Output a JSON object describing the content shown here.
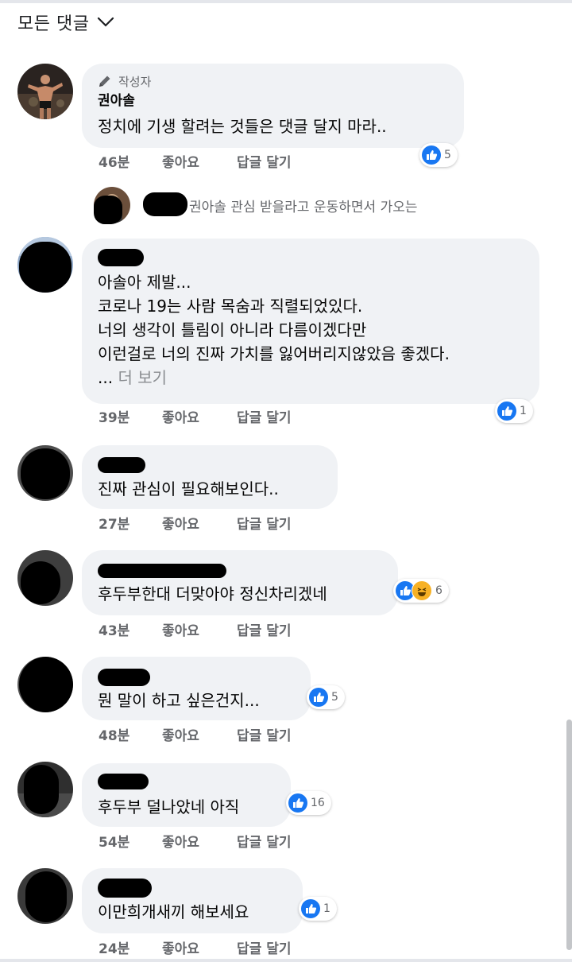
{
  "header": {
    "filter_label": "모든 댓글"
  },
  "action_labels": {
    "like": "좋아요",
    "reply": "답글 달기"
  },
  "comments": [
    {
      "author_badge": "작성자",
      "author": "권아솔",
      "text": "정치에 기생 할려는 것들은 댓글 달지 마라..",
      "time": "46분",
      "reaction_count": "5",
      "reaction_types": [
        "like"
      ]
    },
    {
      "author": "",
      "text": "아솔아 제발...\n코로나 19는 사람 목숨과 직렬되었있다.\n너의 생각이 틀림이 아니라 다름이겠다만\n이런걸로 너의 진짜 가치를 잃어버리지않았음 좋겠다.",
      "see_more_prefix": "... ",
      "see_more": "더 보기",
      "time": "39분",
      "reaction_count": "1",
      "reaction_types": [
        "like"
      ]
    },
    {
      "author": "",
      "text": "진짜 관심이 필요해보인다..",
      "time": "27분",
      "reaction_count": "",
      "reaction_types": []
    },
    {
      "author": "",
      "text": "후두부한대 더맞아야 정신차리겠네",
      "time": "43분",
      "reaction_count": "6",
      "reaction_types": [
        "like",
        "haha"
      ]
    },
    {
      "author": "",
      "text": "뭔 말이 하고 싶은건지...",
      "time": "48분",
      "reaction_count": "5",
      "reaction_types": [
        "like"
      ]
    },
    {
      "author": "",
      "text": "후두부 덜나았네 아직",
      "time": "54분",
      "reaction_count": "16",
      "reaction_types": [
        "like"
      ]
    },
    {
      "author": "",
      "text": "이만희개새끼 해보세요",
      "time": "24분",
      "reaction_count": "1",
      "reaction_types": [
        "like"
      ]
    }
  ],
  "reply_preview": {
    "text": "권아솔 관심 받을라고 운동하면서 가오는"
  },
  "colors": {
    "bubble": "#f0f2f5",
    "like_blue": "#1877f2",
    "meta_gray": "#65676b",
    "haha_yellow": "#f7b125"
  }
}
